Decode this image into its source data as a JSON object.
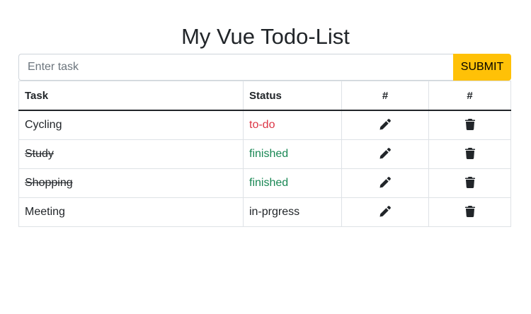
{
  "header": {
    "title": "My Vue Todo-List"
  },
  "form": {
    "placeholder": "Enter task",
    "submit_label": "SUBMIT",
    "value": ""
  },
  "table": {
    "columns": [
      "Task",
      "Status",
      "#",
      "#"
    ],
    "rows": [
      {
        "task": "Cycling",
        "status": "to-do",
        "status_color": "#dc3545",
        "finished": false
      },
      {
        "task": "Study",
        "status": "finished",
        "status_color": "#198754",
        "finished": true
      },
      {
        "task": "Shopping",
        "status": "finished",
        "status_color": "#198754",
        "finished": true
      },
      {
        "task": "Meeting",
        "status": "in-prgress",
        "status_color": "#212529",
        "finished": false
      }
    ],
    "edit_icon": "pencil-icon",
    "delete_icon": "trash-icon"
  },
  "colors": {
    "submit_bg": "#ffc107",
    "header_rule": "#212529"
  }
}
